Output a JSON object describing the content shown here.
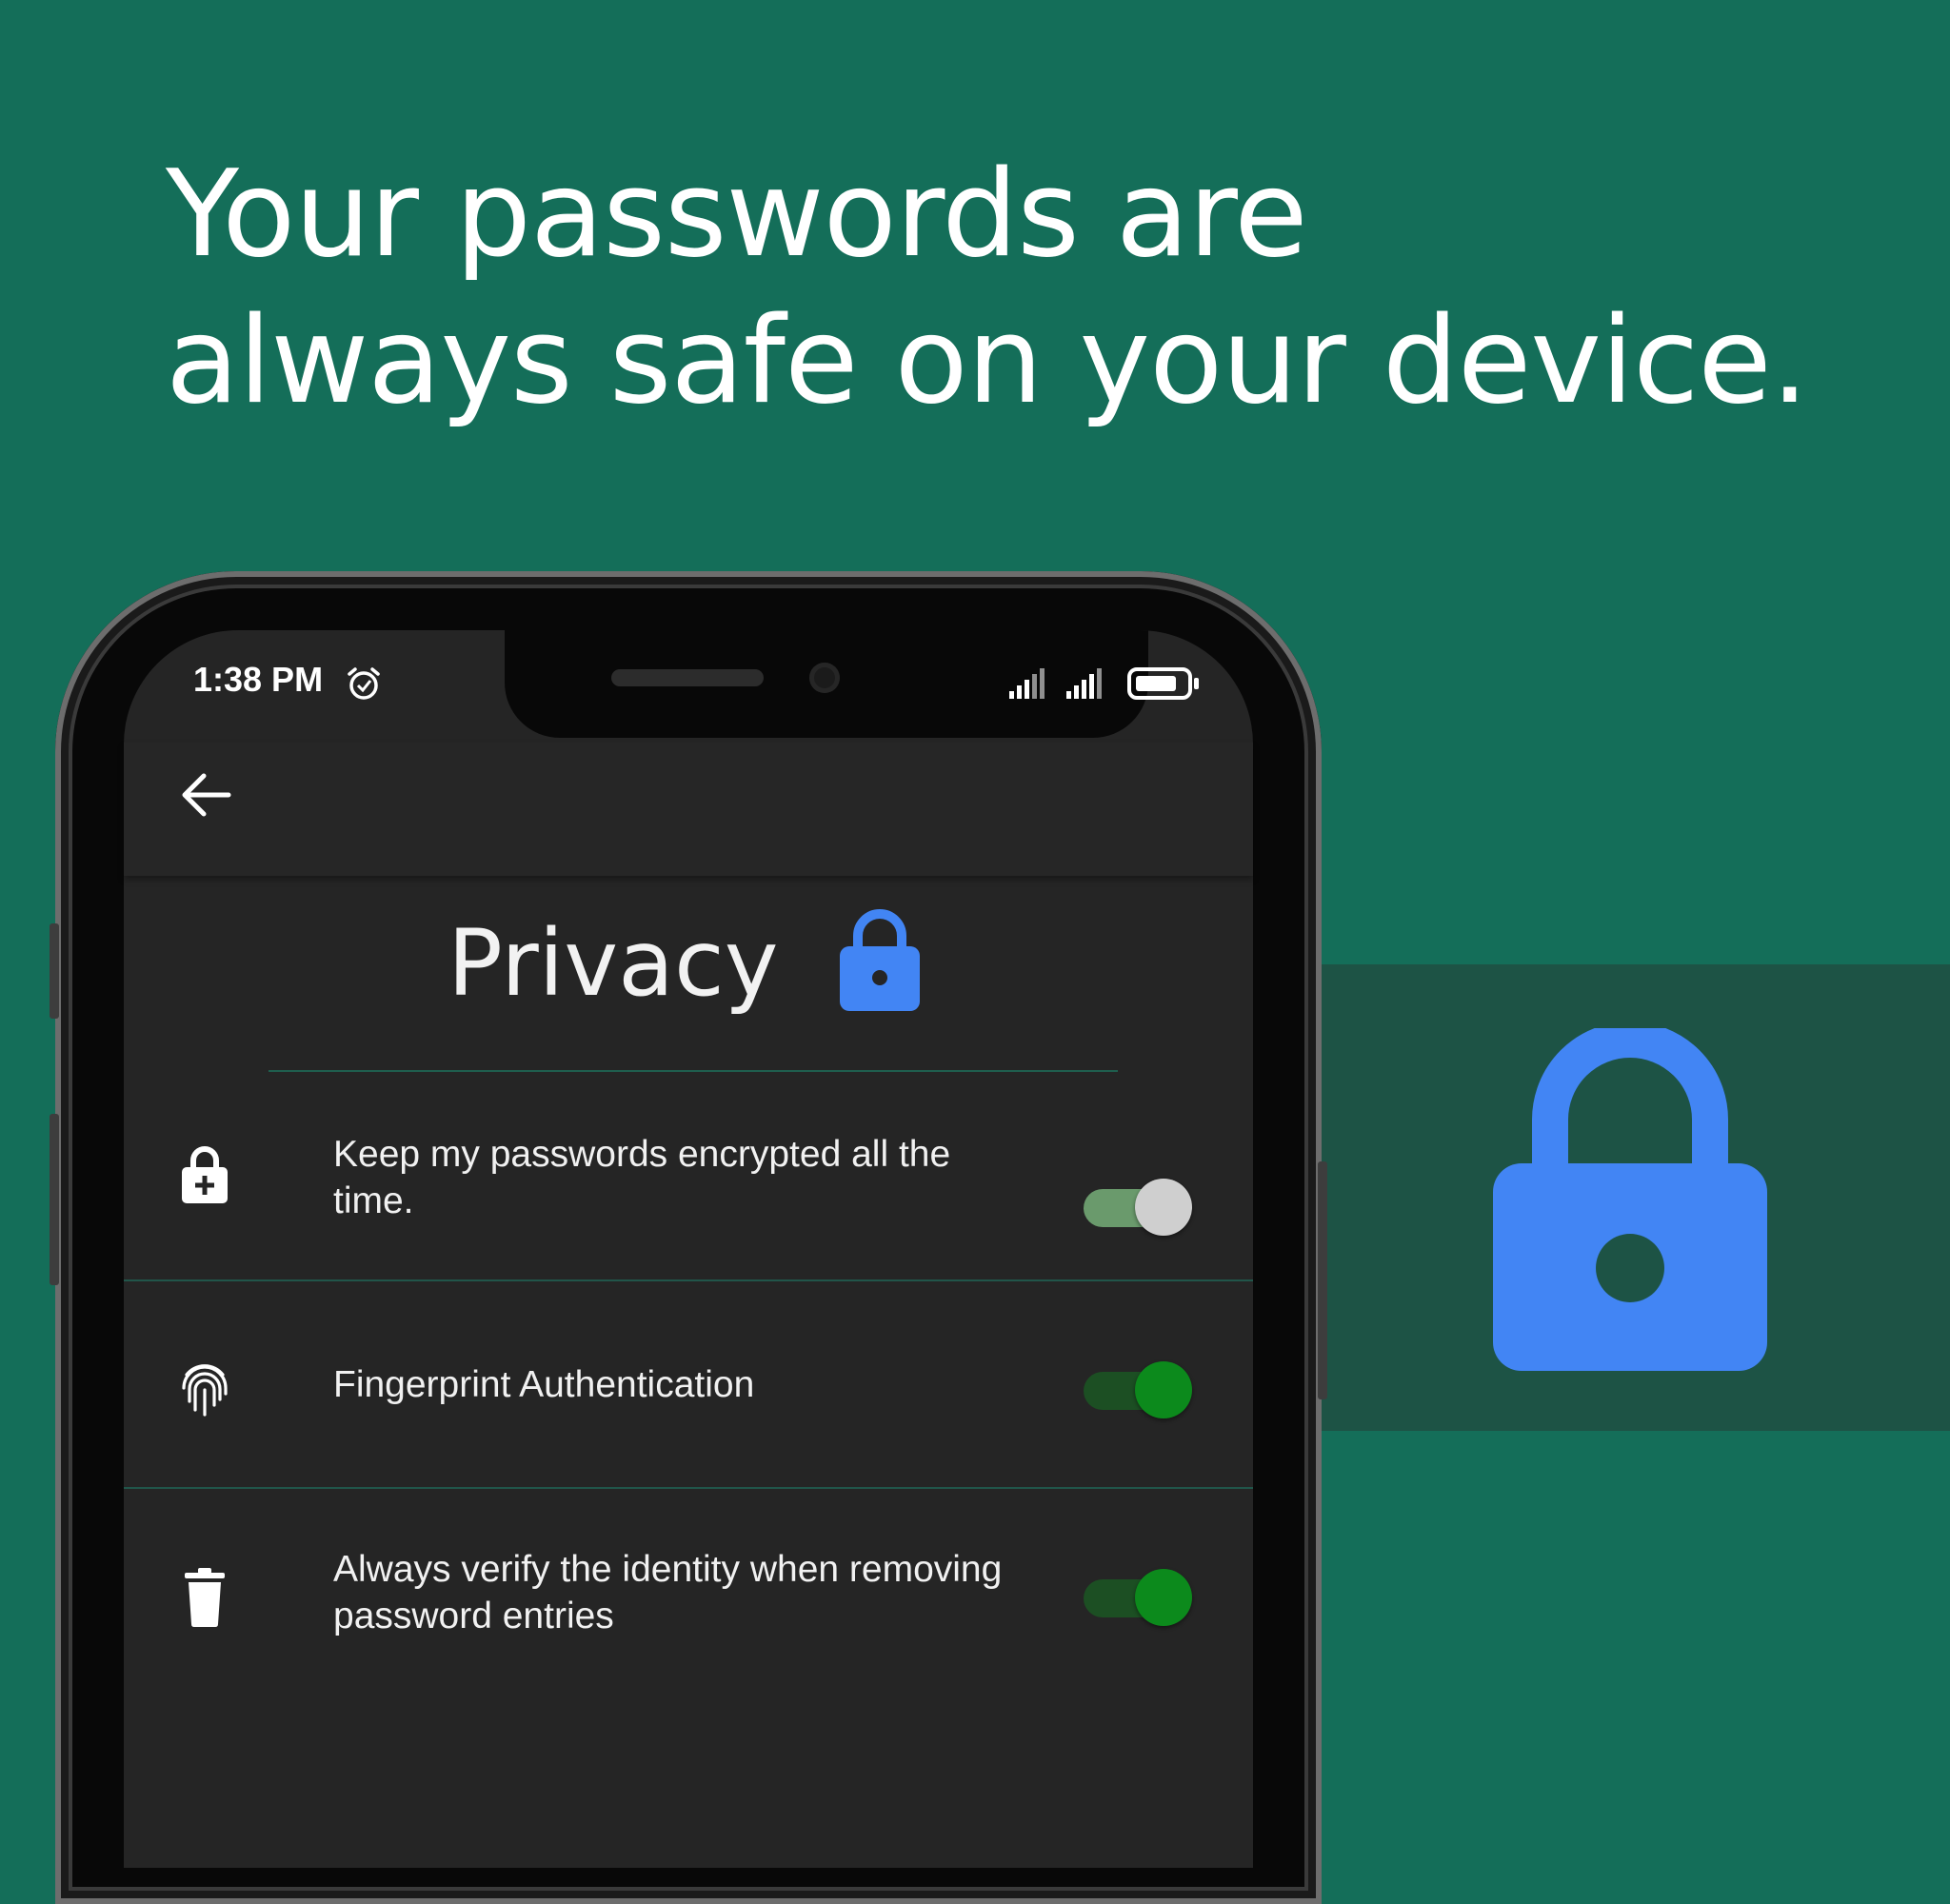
{
  "headline": {
    "line1": "Your passwords are",
    "line2": "always safe on your device."
  },
  "status_bar": {
    "time": "1:38 PM",
    "icons": [
      "alarm-icon",
      "signal-icon",
      "signal-icon",
      "battery-icon"
    ]
  },
  "app_bar": {
    "back_icon": "arrow-left-icon"
  },
  "page": {
    "title": "Privacy",
    "title_icon": "lock-icon"
  },
  "settings": [
    {
      "icon": "lock-plus-icon",
      "label": "Keep my passwords encrypted all the time.",
      "enabled": true,
      "toggle_style": "light-thumb"
    },
    {
      "icon": "fingerprint-icon",
      "label": "Fingerprint Authentication",
      "enabled": true,
      "toggle_style": "green-thumb"
    },
    {
      "icon": "trash-icon",
      "label": "Always verify the identity when removing password entries",
      "enabled": true,
      "toggle_style": "green-thumb"
    }
  ],
  "colors": {
    "background": "#146e59",
    "band": "#1d5345",
    "accent_blue": "#4285f4",
    "toggle_green": "#0c8a1c",
    "toggle_track_green": "#1c4f23",
    "toggle_track_light": "#6a9a6c",
    "toggle_thumb_light": "#cfcfcf",
    "screen_bg": "#252525"
  }
}
